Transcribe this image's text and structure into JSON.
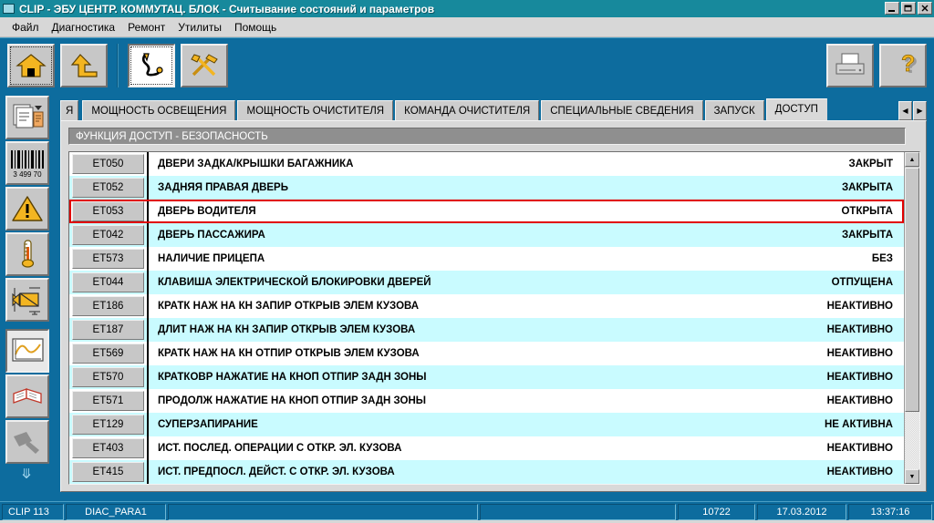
{
  "window": {
    "title": "CLIP - ЭБУ ЦЕНТР. КОММУТАЦ. БЛОК - Считывание состояний и параметров",
    "sysicon": "app-icon",
    "buttons": {
      "minimize": "minimize-icon",
      "restore": "restore-icon",
      "close": "close-icon"
    }
  },
  "menu": {
    "items": [
      {
        "label": "Файл"
      },
      {
        "label": "Диагностика"
      },
      {
        "label": "Ремонт"
      },
      {
        "label": "Утилиты"
      },
      {
        "label": "Помощь"
      }
    ]
  },
  "toolbar": {
    "left": [
      {
        "name": "home-button",
        "icon": "home-icon",
        "state": "focused"
      },
      {
        "name": "back-button",
        "icon": "arrow-up-left-icon",
        "state": "normal"
      },
      {
        "name": "diagnostics-button",
        "icon": "stethoscope-icon",
        "state": "selected"
      },
      {
        "name": "tools-button",
        "icon": "tools-icon",
        "state": "normal"
      }
    ],
    "right": [
      {
        "name": "print-button",
        "icon": "printer-icon"
      },
      {
        "name": "help-button",
        "icon": "question-mark-icon"
      }
    ]
  },
  "sidebar": {
    "items": [
      {
        "name": "sidebar-item-documents",
        "icon": "documents-icon",
        "active": false
      },
      {
        "name": "sidebar-item-barcode",
        "icon": "barcode-icon",
        "active": false,
        "barcode_digits": "3  499 70"
      },
      {
        "name": "sidebar-item-faults",
        "icon": "warning-triangle-icon",
        "active": false
      },
      {
        "name": "sidebar-item-parameters",
        "icon": "thermometer-icon",
        "active": false
      },
      {
        "name": "sidebar-item-actuators",
        "icon": "actuator-icon",
        "active": false
      },
      {
        "name": "sidebar-item-graph",
        "icon": "graph-icon",
        "active": true
      },
      {
        "name": "sidebar-item-documentation",
        "icon": "book-icon",
        "active": false
      },
      {
        "name": "sidebar-item-tests",
        "icon": "gavel-icon",
        "active": false,
        "disabled": true
      }
    ],
    "scroll_down_icon": "chevron-double-down-icon"
  },
  "tabs": {
    "items": [
      {
        "label": "Я",
        "active": false,
        "clipped": true
      },
      {
        "label": "МОЩНОСТЬ ОСВЕЩЕНИЯ",
        "active": false
      },
      {
        "label": "МОЩНОСТЬ ОЧИСТИТЕЛЯ",
        "active": false
      },
      {
        "label": "КОМАНДА ОЧИСТИТЕЛЯ",
        "active": false
      },
      {
        "label": "СПЕЦИАЛЬНЫЕ СВЕДЕНИЯ",
        "active": false
      },
      {
        "label": "ЗАПУСК",
        "active": false
      },
      {
        "label": "ДОСТУП",
        "active": true
      }
    ],
    "nav_prev_icon": "triangle-left-icon",
    "nav_next_icon": "triangle-right-icon"
  },
  "content": {
    "section_title": "ФУНКЦИЯ ДОСТУП - БЕЗОПАСНОСТЬ",
    "highlighted_row_index": 2,
    "highlight_color": "#e00000",
    "row_alt_color": "#c9fbff",
    "rows": [
      {
        "code": "ET050",
        "name": "ДВЕРИ ЗАДКА/КРЫШКИ БАГАЖНИКА",
        "value": "ЗАКРЫТ"
      },
      {
        "code": "ET052",
        "name": "ЗАДНЯЯ ПРАВАЯ ДВЕРЬ",
        "value": "ЗАКРЫТА"
      },
      {
        "code": "ET053",
        "name": "ДВЕРЬ ВОДИТЕЛЯ",
        "value": "ОТКРЫТА"
      },
      {
        "code": "ET042",
        "name": "ДВЕРЬ ПАССАЖИРА",
        "value": "ЗАКРЫТА"
      },
      {
        "code": "ET573",
        "name": "НАЛИЧИЕ ПРИЦЕПА",
        "value": "БЕЗ"
      },
      {
        "code": "ET044",
        "name": "КЛАВИША ЭЛЕКТРИЧЕСКОЙ БЛОКИРОВКИ ДВЕРЕЙ",
        "value": "ОТПУЩЕНА"
      },
      {
        "code": "ET186",
        "name": "КРАТК НАЖ НА КН ЗАПИР ОТКРЫВ ЭЛЕМ КУЗОВА",
        "value": "НЕАКТИВНО"
      },
      {
        "code": "ET187",
        "name": "ДЛИТ НАЖ НА КН ЗАПИР ОТКРЫВ ЭЛЕМ КУЗОВА",
        "value": "НЕАКТИВНО"
      },
      {
        "code": "ET569",
        "name": "КРАТК НАЖ НА КН ОТПИР ОТКРЫВ ЭЛЕМ КУЗОВА",
        "value": "НЕАКТИВНО"
      },
      {
        "code": "ET570",
        "name": "КРАТКОВР НАЖАТИЕ НА КНОП ОТПИР ЗАДН ЗОНЫ",
        "value": "НЕАКТИВНО"
      },
      {
        "code": "ET571",
        "name": "ПРОДОЛЖ НАЖАТИЕ НА КНОП ОТПИР ЗАДН ЗОНЫ",
        "value": "НЕАКТИВНО"
      },
      {
        "code": "ET129",
        "name": "СУПЕРЗАПИРАНИЕ",
        "value": "НЕ АКТИВНА"
      },
      {
        "code": "ET403",
        "name": "ИСТ. ПОСЛЕД. ОПЕРАЦИИ С ОТКР. ЭЛ. КУЗОВА",
        "value": "НЕАКТИВНО"
      },
      {
        "code": "ET415",
        "name": "ИСТ. ПРЕДПОСЛ. ДЕЙСТ. С ОТКР. ЭЛ. КУЗОВА",
        "value": "НЕАКТИВНО"
      }
    ]
  },
  "scrollbar": {
    "up_icon": "triangle-up-icon",
    "down_icon": "triangle-down-icon"
  },
  "statusbar": {
    "app": "CLIP 113",
    "profile": "DIAC_PARA1",
    "field3": "",
    "field4": "",
    "counter": "10722",
    "date": "17.03.2012",
    "time": "13:37:16"
  }
}
